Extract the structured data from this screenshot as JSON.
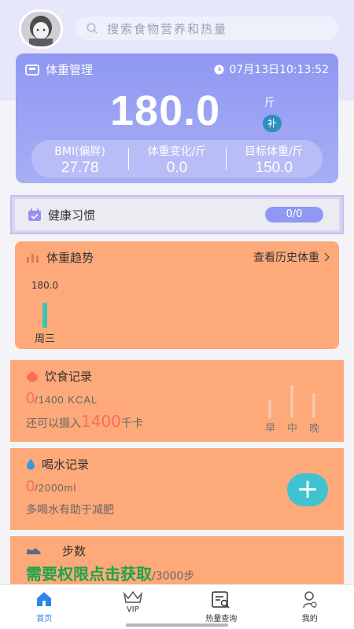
{
  "search": {
    "placeholder": "搜索食物营养和热量"
  },
  "weight_card": {
    "title": "体重管理",
    "timestamp": "07月13日10:13:52",
    "current_weight": "180.0",
    "unit": "斤",
    "fill_label": "补",
    "stats": [
      {
        "label": "BMI(偏胖)",
        "value": "27.78"
      },
      {
        "label": "体重变化/斤",
        "value": "0.0"
      },
      {
        "label": "目标体重/斤",
        "value": "150.0"
      }
    ]
  },
  "habit": {
    "label": "健康习惯",
    "progress": "0/0"
  },
  "trend": {
    "title": "体重趋势",
    "link": "查看历史体重",
    "chart_data": {
      "type": "bar",
      "categories": [
        "周三"
      ],
      "values": [
        180.0
      ],
      "data_labels": [
        "180.0"
      ]
    }
  },
  "diet": {
    "title": "饮食记录",
    "consumed": "0",
    "target": "/1400 KCAL",
    "remaining_prefix": "还可以摄入",
    "remaining_value": "1400",
    "remaining_unit": "千卡",
    "meals": [
      "早",
      "中",
      "晚"
    ]
  },
  "water": {
    "title": "喝水记录",
    "consumed": "0",
    "target": "/2000ml",
    "tip": "多喝水有助于减肥",
    "add_symbol": "+"
  },
  "steps": {
    "title": "步数",
    "status": "需要权限点击获取",
    "target": "/3000步"
  },
  "nav": {
    "items": [
      {
        "label": "首页",
        "icon": "home-icon"
      },
      {
        "label": "VIP",
        "icon": "crown-icon"
      },
      {
        "label": "热量查询",
        "icon": "calorie-search-icon"
      },
      {
        "label": "我的",
        "icon": "profile-icon"
      }
    ]
  },
  "colors": {
    "accent": "#8f98f2",
    "card_orange": "#fea97a",
    "alert_red": "#ff6b5a",
    "steps_green": "#1fa34a",
    "nav_active": "#2a86e8",
    "plus_teal": "#3fc3d0"
  }
}
